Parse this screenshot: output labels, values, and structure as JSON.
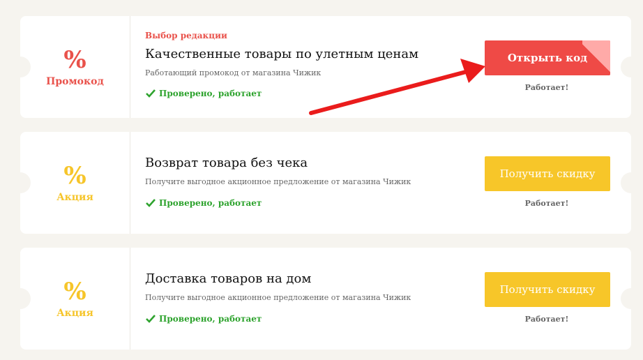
{
  "colors": {
    "background": "#f6f4ef",
    "accent_red": "#e9524b",
    "accent_yellow": "#f6c52a",
    "verified_green": "#2ea32e",
    "arrow_red": "#ea1c1c"
  },
  "coupons": [
    {
      "type": "promo",
      "percent_symbol": "%",
      "kind_label": "Промокод",
      "editor_label": "Выбор редакции",
      "title": "Качественные товары по улетным ценам",
      "description": "Работающий промокод от магазина Чижик",
      "verified": "Проверено, работает",
      "button_label": "Открыть код",
      "status": "Работает!"
    },
    {
      "type": "deal",
      "percent_symbol": "%",
      "kind_label": "Акция",
      "title": "Возврат товара без чека",
      "description": "Получите выгодное акционное предложение от магазина Чижик",
      "verified": "Проверено, работает",
      "button_label": "Получить скидку",
      "status": "Работает!"
    },
    {
      "type": "deal",
      "percent_symbol": "%",
      "kind_label": "Акция",
      "title": "Доставка товаров на дом",
      "description": "Получите выгодное акционное предложение от магазина Чижик",
      "verified": "Проверено, работает",
      "button_label": "Получить скидку",
      "status": "Работает!"
    }
  ],
  "icons": {
    "check": "check-icon",
    "arrow": "pointer-arrow-icon"
  }
}
